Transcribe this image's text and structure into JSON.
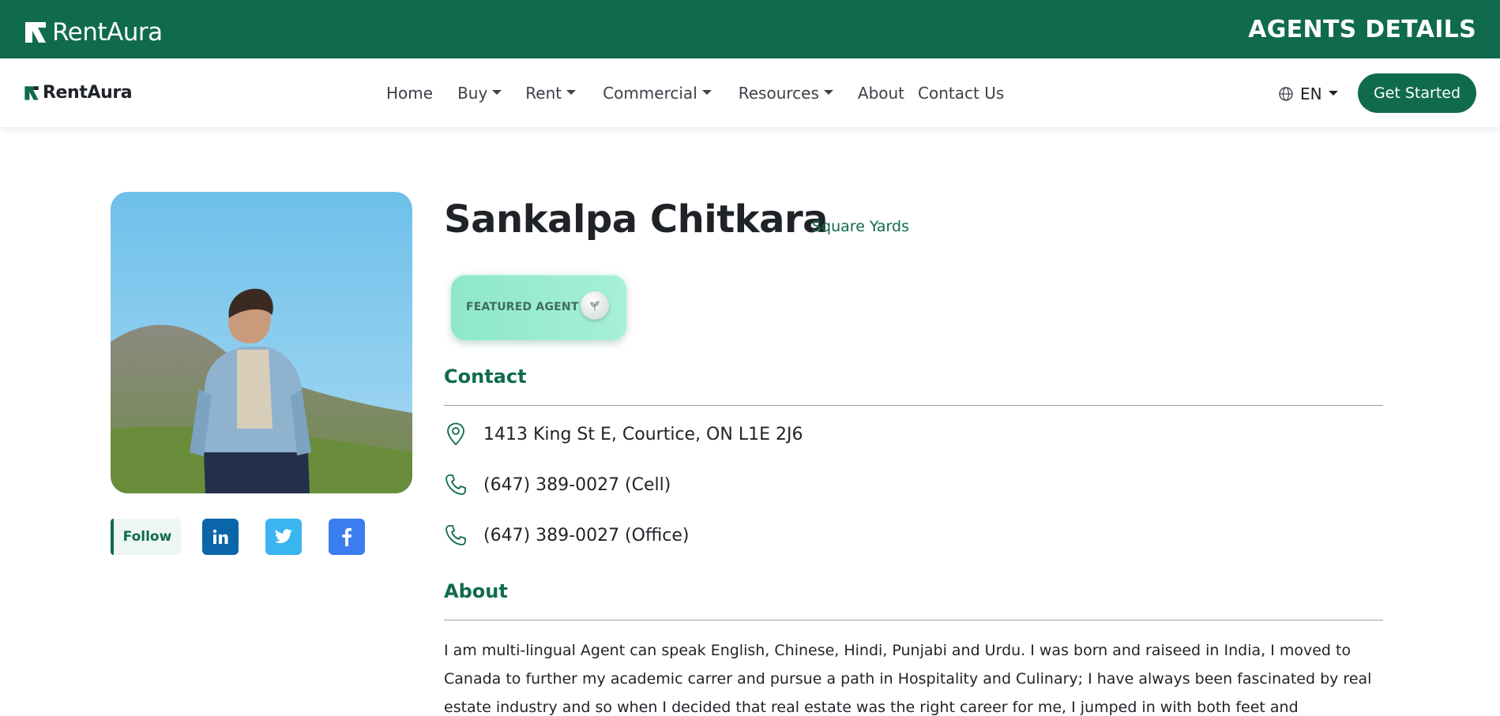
{
  "app": {
    "brand": "RentAura",
    "page_label": "AGENTS DETAILS"
  },
  "navbar": {
    "brand": "RentAura",
    "links": [
      {
        "label": "Home",
        "dropdown": false
      },
      {
        "label": "Buy",
        "dropdown": true
      },
      {
        "label": "Rent",
        "dropdown": true
      },
      {
        "label": "Commercial",
        "dropdown": true
      },
      {
        "label": "Resources",
        "dropdown": true
      },
      {
        "label": "About",
        "dropdown": false
      },
      {
        "label": "Contact Us",
        "dropdown": false
      }
    ],
    "language": "EN",
    "cta": "Get Started"
  },
  "agent": {
    "name": "Sankalpa Chitkara",
    "company": "Square Yards",
    "badge": "FEATURED AGENT"
  },
  "social": {
    "follow": "Follow",
    "icons": [
      "linkedin-icon",
      "twitter-icon",
      "facebook-icon"
    ]
  },
  "contact": {
    "title": "Contact",
    "address": "1413 King St E, Courtice, ON L1E 2J6",
    "cell": "(647) 389-0027 (Cell)",
    "office": "(647) 389-0027 (Office)"
  },
  "about": {
    "title": "About",
    "text": "I am multi-lingual Agent can speak English, Chinese, Hindi, Punjabi and Urdu. I was born and raiseed in India, I moved to Canada to further my academic carrer and pursue a path in Hospitality and Culinary; I have always been fascinated by real estate industry and so when I decided that real estate was the right career for me, I jumped in with both feet and"
  },
  "colors": {
    "brand_green": "#0f6b4b",
    "badge_mint": "#8ee8c8",
    "linkedin": "#0a66a8",
    "twitter": "#3ab5f0",
    "facebook": "#3b7ef0"
  }
}
